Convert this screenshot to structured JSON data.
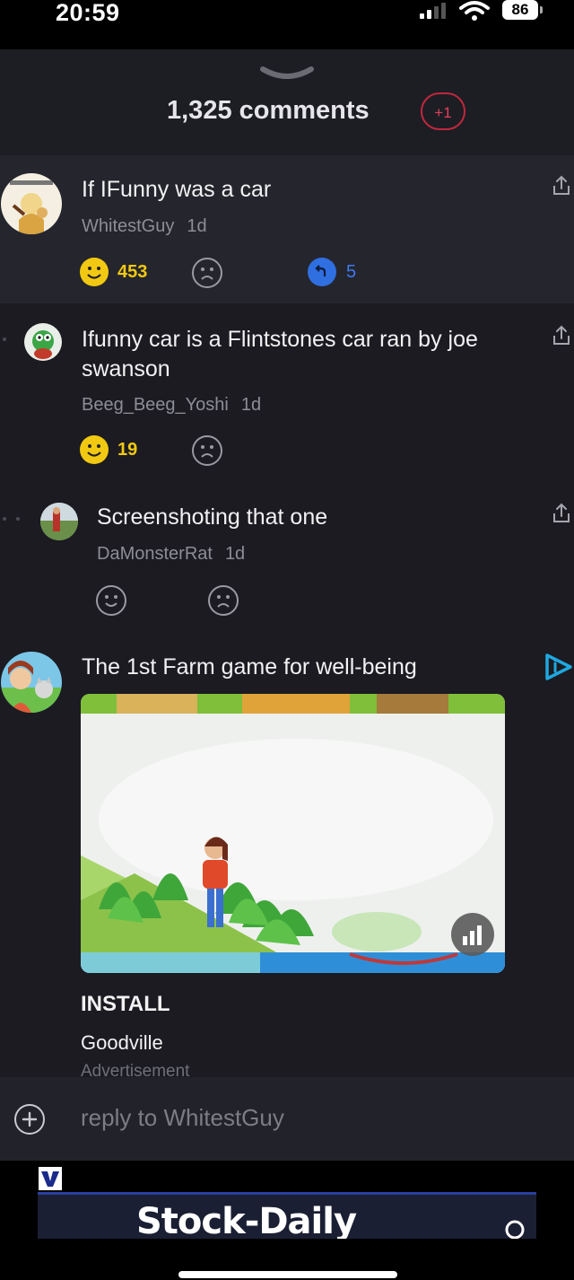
{
  "status": {
    "time": "20:59",
    "battery": "86"
  },
  "header": {
    "title": "1,325 comments",
    "new_badge": "+1"
  },
  "comments": [
    {
      "text": "If IFunny was a car",
      "author": "WhitestGuy",
      "ago": "1d",
      "smiles": "453",
      "replies": "5"
    },
    {
      "text": "Ifunny car is a Flintstones car ran by joe swanson",
      "author": "Beeg_Beeg_Yoshi",
      "ago": "1d",
      "smiles": "19"
    },
    {
      "text": "Screenshoting that one",
      "author": "DaMonsterRat",
      "ago": "1d"
    }
  ],
  "ad": {
    "title": "The 1st Farm game for well-being",
    "cta": "INSTALL",
    "advertiser": "Goodville",
    "label": "Advertisement"
  },
  "reply_bar": {
    "placeholder": "reply to WhitestGuy"
  },
  "banner": {
    "text": "Stock-Daily"
  },
  "colors": {
    "accent_yellow": "#f2c912",
    "reply_blue": "#2f6fe0",
    "badge_red": "#c0283c",
    "ad_icon": "#1fa7e0"
  },
  "icons": [
    "chevron-down-icon",
    "share-icon",
    "smile-icon",
    "frown-icon",
    "reply-icon",
    "adchoices-icon",
    "stats-icon",
    "add-icon"
  ]
}
